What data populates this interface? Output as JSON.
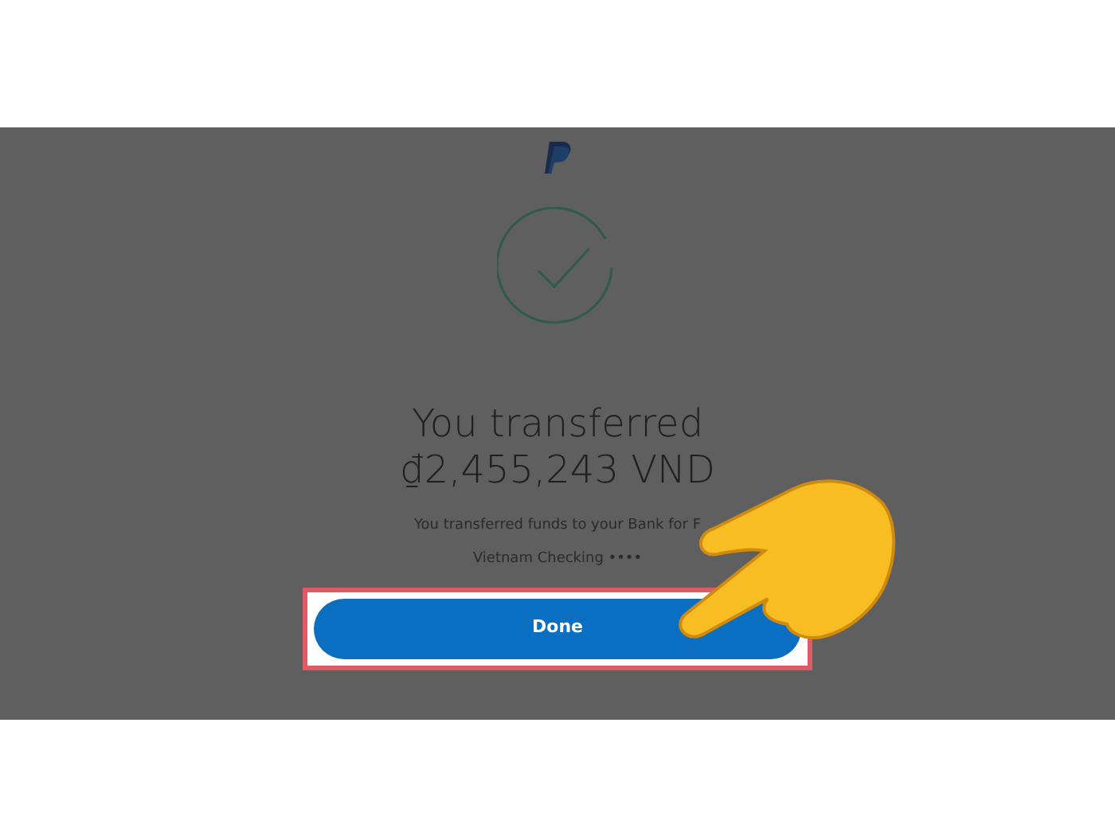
{
  "title": [
    "You transferred",
    "₫2,455,243 VND"
  ],
  "message": [
    "You transferred funds to your Bank for F",
    "Vietnam Checking ••••"
  ],
  "done_button": {
    "label": "Done",
    "highlighted": true
  }
}
